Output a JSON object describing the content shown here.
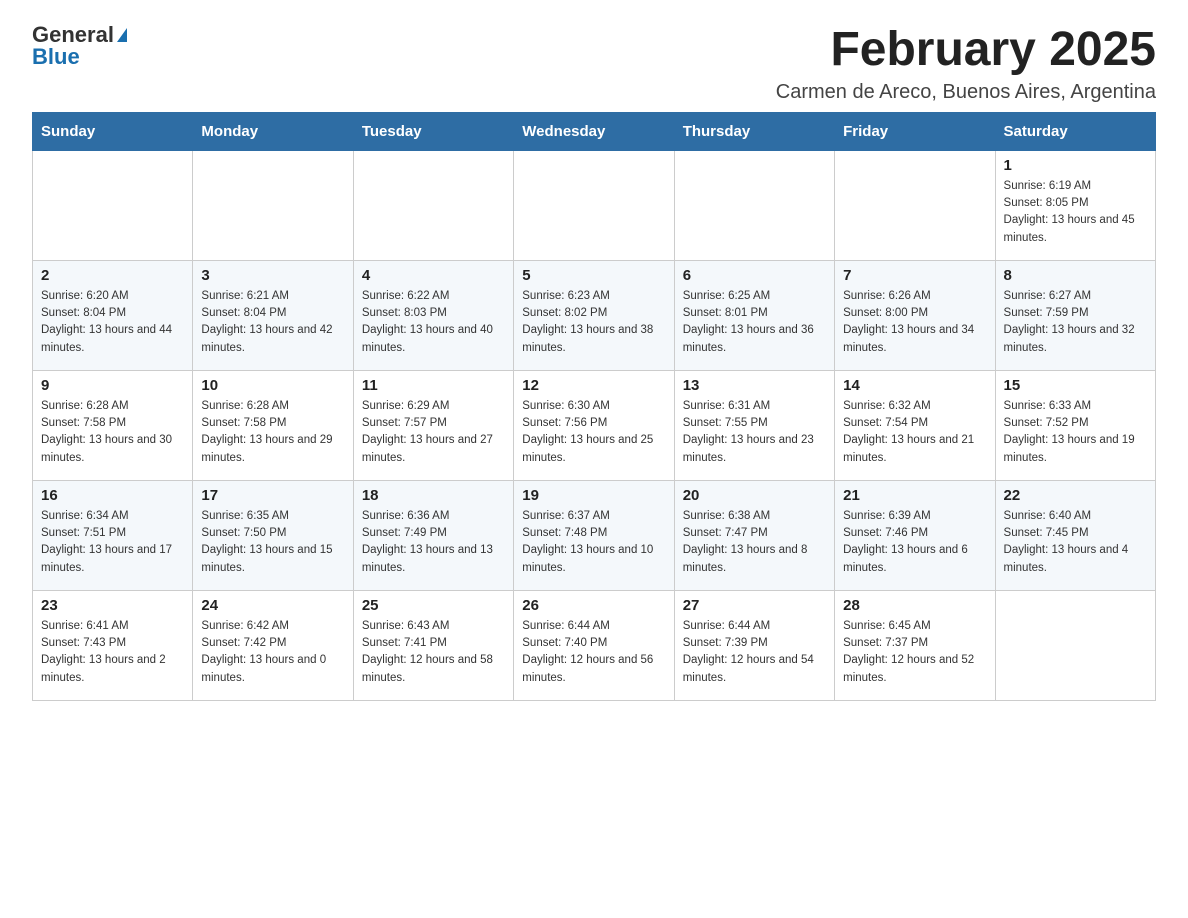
{
  "header": {
    "logo_general": "General",
    "logo_blue": "Blue",
    "month_title": "February 2025",
    "location": "Carmen de Areco, Buenos Aires, Argentina"
  },
  "weekdays": [
    "Sunday",
    "Monday",
    "Tuesday",
    "Wednesday",
    "Thursday",
    "Friday",
    "Saturday"
  ],
  "weeks": [
    [
      {
        "day": "",
        "info": ""
      },
      {
        "day": "",
        "info": ""
      },
      {
        "day": "",
        "info": ""
      },
      {
        "day": "",
        "info": ""
      },
      {
        "day": "",
        "info": ""
      },
      {
        "day": "",
        "info": ""
      },
      {
        "day": "1",
        "info": "Sunrise: 6:19 AM\nSunset: 8:05 PM\nDaylight: 13 hours and 45 minutes."
      }
    ],
    [
      {
        "day": "2",
        "info": "Sunrise: 6:20 AM\nSunset: 8:04 PM\nDaylight: 13 hours and 44 minutes."
      },
      {
        "day": "3",
        "info": "Sunrise: 6:21 AM\nSunset: 8:04 PM\nDaylight: 13 hours and 42 minutes."
      },
      {
        "day": "4",
        "info": "Sunrise: 6:22 AM\nSunset: 8:03 PM\nDaylight: 13 hours and 40 minutes."
      },
      {
        "day": "5",
        "info": "Sunrise: 6:23 AM\nSunset: 8:02 PM\nDaylight: 13 hours and 38 minutes."
      },
      {
        "day": "6",
        "info": "Sunrise: 6:25 AM\nSunset: 8:01 PM\nDaylight: 13 hours and 36 minutes."
      },
      {
        "day": "7",
        "info": "Sunrise: 6:26 AM\nSunset: 8:00 PM\nDaylight: 13 hours and 34 minutes."
      },
      {
        "day": "8",
        "info": "Sunrise: 6:27 AM\nSunset: 7:59 PM\nDaylight: 13 hours and 32 minutes."
      }
    ],
    [
      {
        "day": "9",
        "info": "Sunrise: 6:28 AM\nSunset: 7:58 PM\nDaylight: 13 hours and 30 minutes."
      },
      {
        "day": "10",
        "info": "Sunrise: 6:28 AM\nSunset: 7:58 PM\nDaylight: 13 hours and 29 minutes."
      },
      {
        "day": "11",
        "info": "Sunrise: 6:29 AM\nSunset: 7:57 PM\nDaylight: 13 hours and 27 minutes."
      },
      {
        "day": "12",
        "info": "Sunrise: 6:30 AM\nSunset: 7:56 PM\nDaylight: 13 hours and 25 minutes."
      },
      {
        "day": "13",
        "info": "Sunrise: 6:31 AM\nSunset: 7:55 PM\nDaylight: 13 hours and 23 minutes."
      },
      {
        "day": "14",
        "info": "Sunrise: 6:32 AM\nSunset: 7:54 PM\nDaylight: 13 hours and 21 minutes."
      },
      {
        "day": "15",
        "info": "Sunrise: 6:33 AM\nSunset: 7:52 PM\nDaylight: 13 hours and 19 minutes."
      }
    ],
    [
      {
        "day": "16",
        "info": "Sunrise: 6:34 AM\nSunset: 7:51 PM\nDaylight: 13 hours and 17 minutes."
      },
      {
        "day": "17",
        "info": "Sunrise: 6:35 AM\nSunset: 7:50 PM\nDaylight: 13 hours and 15 minutes."
      },
      {
        "day": "18",
        "info": "Sunrise: 6:36 AM\nSunset: 7:49 PM\nDaylight: 13 hours and 13 minutes."
      },
      {
        "day": "19",
        "info": "Sunrise: 6:37 AM\nSunset: 7:48 PM\nDaylight: 13 hours and 10 minutes."
      },
      {
        "day": "20",
        "info": "Sunrise: 6:38 AM\nSunset: 7:47 PM\nDaylight: 13 hours and 8 minutes."
      },
      {
        "day": "21",
        "info": "Sunrise: 6:39 AM\nSunset: 7:46 PM\nDaylight: 13 hours and 6 minutes."
      },
      {
        "day": "22",
        "info": "Sunrise: 6:40 AM\nSunset: 7:45 PM\nDaylight: 13 hours and 4 minutes."
      }
    ],
    [
      {
        "day": "23",
        "info": "Sunrise: 6:41 AM\nSunset: 7:43 PM\nDaylight: 13 hours and 2 minutes."
      },
      {
        "day": "24",
        "info": "Sunrise: 6:42 AM\nSunset: 7:42 PM\nDaylight: 13 hours and 0 minutes."
      },
      {
        "day": "25",
        "info": "Sunrise: 6:43 AM\nSunset: 7:41 PM\nDaylight: 12 hours and 58 minutes."
      },
      {
        "day": "26",
        "info": "Sunrise: 6:44 AM\nSunset: 7:40 PM\nDaylight: 12 hours and 56 minutes."
      },
      {
        "day": "27",
        "info": "Sunrise: 6:44 AM\nSunset: 7:39 PM\nDaylight: 12 hours and 54 minutes."
      },
      {
        "day": "28",
        "info": "Sunrise: 6:45 AM\nSunset: 7:37 PM\nDaylight: 12 hours and 52 minutes."
      },
      {
        "day": "",
        "info": ""
      }
    ]
  ]
}
